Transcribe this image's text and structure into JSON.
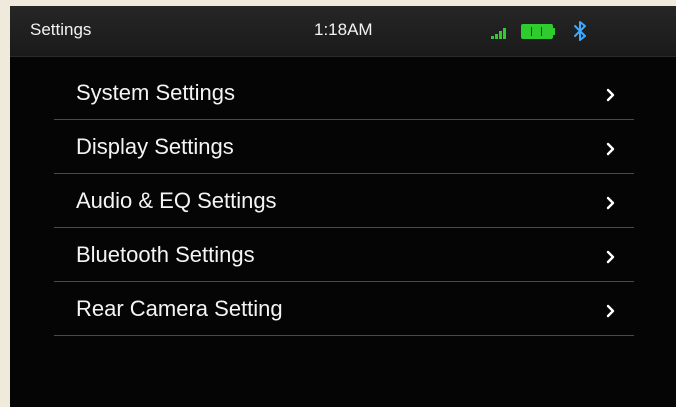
{
  "status_bar": {
    "title": "Settings",
    "time": "1:18AM",
    "icons": [
      "signal-strength-icon",
      "battery-icon",
      "bluetooth-icon"
    ],
    "status_color": "#2ecc2e"
  },
  "menu": {
    "items": [
      {
        "label": "System Settings",
        "icon": "chevron-right-icon"
      },
      {
        "label": "Display Settings",
        "icon": "chevron-right-icon"
      },
      {
        "label": "Audio & EQ Settings",
        "icon": "chevron-right-icon"
      },
      {
        "label": "Bluetooth Settings",
        "icon": "chevron-right-icon"
      },
      {
        "label": "Rear Camera Setting",
        "icon": "chevron-right-icon"
      }
    ]
  }
}
